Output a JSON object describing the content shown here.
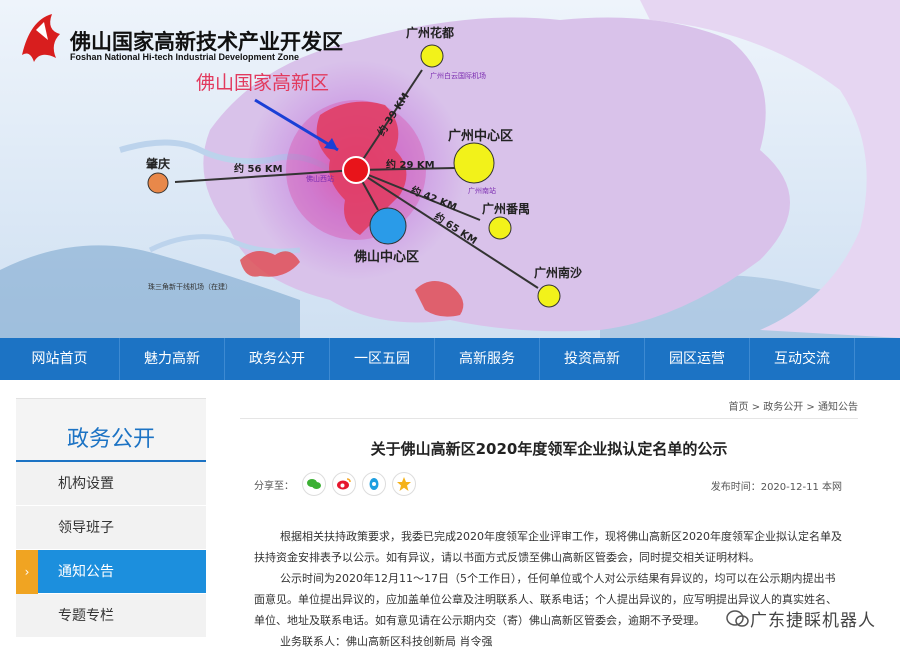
{
  "header": {
    "org_name_cn": "佛山国家高新技术产业开发区",
    "org_name_en": "Foshan National Hi-tech Industrial Development Zone",
    "map_callout": "佛山国家高新区"
  },
  "map": {
    "nodes": {
      "huadu": "广州花都",
      "airport": "广州白云国际机场",
      "gz_center": "广州中心区",
      "gz_south_station": "广州南站",
      "panyu": "广州番禺",
      "nansha": "广州南沙",
      "zhaoqing": "肇庆",
      "foshan_west": "佛山西站",
      "foshan_center": "佛山中心区",
      "zhusanjiao_airport": "珠三角新干线机场（在建）"
    },
    "distances": {
      "to_huadu": "约 39 KM",
      "to_gz_center": "约 29 KM",
      "to_panyu": "约 42 KM",
      "to_nansha": "约 65 KM",
      "to_zhaoqing": "约 56 KM"
    },
    "colors": {
      "hub": "#e8141a",
      "guangzhou": "#f2f21a",
      "foshan": "#2a9be8",
      "zhaoqing": "#e8884a"
    }
  },
  "nav": {
    "items": [
      "网站首页",
      "魅力高新",
      "政务公开",
      "一区五园",
      "高新服务",
      "投资高新",
      "园区运营",
      "互动交流"
    ]
  },
  "sidebar": {
    "title": "政务公开",
    "items": [
      "机构设置",
      "领导班子",
      "通知公告",
      "专题专栏"
    ],
    "active_marker": "›"
  },
  "breadcrumb": "首页 > 政务公开 > 通知公告",
  "article": {
    "title": "关于佛山高新区2020年度领军企业拟认定名单的公示",
    "share_label": "分享至：",
    "publish": "发布时间：2020-12-11 本网",
    "paragraphs": [
      "根据相关扶持政策要求，我委已完成2020年度领军企业评审工作，现将佛山高新区2020年度领军企业拟认定名单及扶持资金安排表予以公示。如有异议，请以书面方式反馈至佛山高新区管委会，同时提交相关证明材料。",
      "公示时间为2020年12月11～17日（5个工作日），任何单位或个人对公示结果有异议的，均可以在公示期内提出书面意见。单位提出异议的，应加盖单位公章及注明联系人、联系电话；个人提出异议的，应写明提出异议人的真实姓名、单位、地址及联系电话。如有意见请在公示期内交（寄）佛山高新区管委会，逾期不予受理。",
      "业务联系人：佛山高新区科技创新局 肖令强"
    ]
  },
  "watermark": "广东捷睬机器人"
}
